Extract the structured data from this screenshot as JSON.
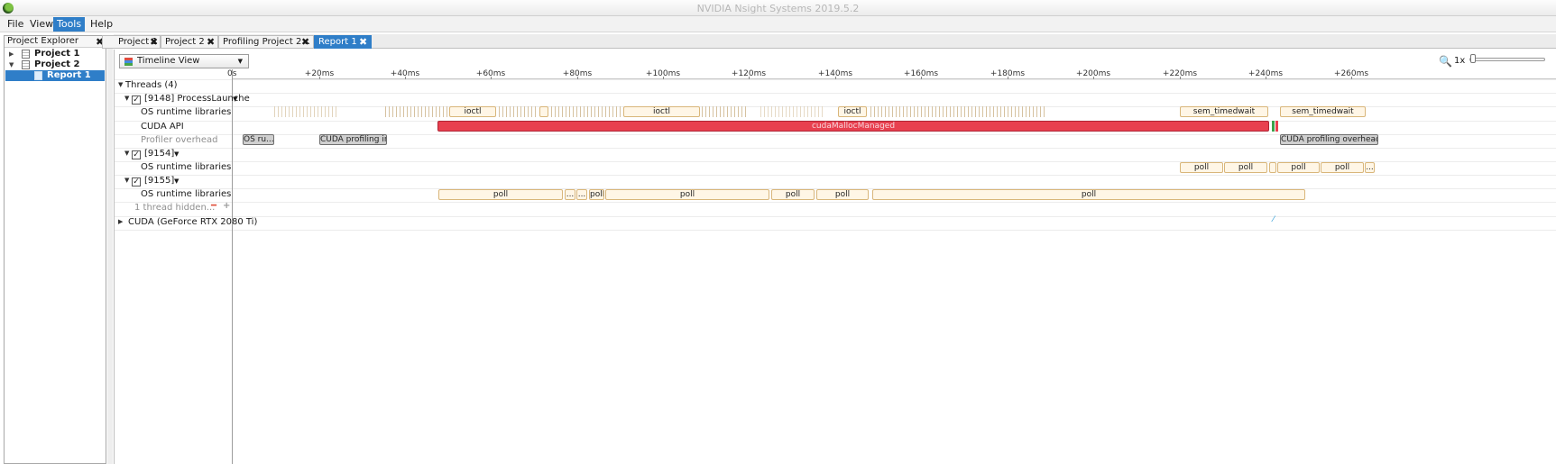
{
  "window": {
    "title": "NVIDIA Nsight Systems 2019.5.2"
  },
  "menu": {
    "file": "File",
    "view": "View",
    "tools": "Tools",
    "help": "Help"
  },
  "explorer": {
    "title": "Project Explorer",
    "items": [
      {
        "label": "Project 1",
        "expanded": false
      },
      {
        "label": "Project 2",
        "expanded": true
      },
      {
        "label": "Report 1",
        "selected": true
      }
    ]
  },
  "tabs": [
    {
      "label": "Project 1"
    },
    {
      "label": "Project 2"
    },
    {
      "label": "Profiling Project 2..."
    },
    {
      "label": "Report 1",
      "active": true
    }
  ],
  "toolbar": {
    "view_mode": "Timeline View",
    "zoom_level": "1x"
  },
  "ruler": {
    "origin_label": "0s",
    "ticks": [
      "+20ms",
      "+40ms",
      "+60ms",
      "+80ms",
      "+100ms",
      "+120ms",
      "+140ms",
      "+160ms",
      "+180ms",
      "+200ms",
      "+220ms",
      "+240ms",
      "+260ms"
    ]
  },
  "tree": {
    "threads_header": "Threads (4)",
    "thread_9148": "[9148] ProcessLaunche",
    "os_runtime": "OS runtime libraries",
    "cuda_api": "CUDA API",
    "profiler_overhead": "Profiler overhead",
    "thread_9154": "[9154]",
    "thread_9155": "[9155]",
    "hidden_threads": "1 thread hidden...",
    "gpu_row": "CUDA (GeForce RTX 2080 Ti)"
  },
  "events": {
    "ioctl": "ioctl",
    "sem_timedwait": "sem_timedwait",
    "cuda_malloc": "cudaMallocManaged",
    "os_ru": "OS ru...",
    "cuda_profiling_in": "CUDA profiling in...",
    "cuda_profiling_overhead": "CUDA profiling overhead",
    "poll": "poll",
    "ellipsis": "..."
  },
  "colors": {
    "selection": "#2f7ec8",
    "cuda_api": "#e8404f",
    "os_runtime": "#fff6e6",
    "profiler": "#cfcfcf"
  }
}
